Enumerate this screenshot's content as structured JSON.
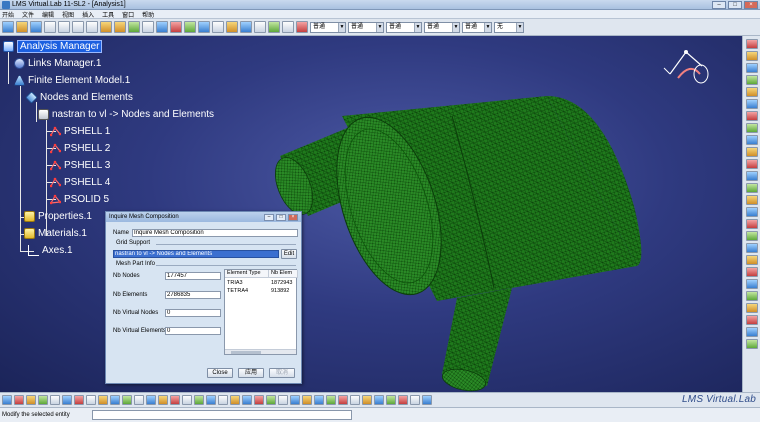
{
  "window": {
    "title": "LMS Virtual.Lab 11-SL2 - [Analysis1]",
    "controls": [
      "–",
      "□",
      "×"
    ]
  },
  "menu": [
    "开始",
    "文件",
    "编辑",
    "视图",
    "插入",
    "工具",
    "窗口",
    "帮助"
  ],
  "toolbar": {
    "selects": [
      "普通",
      "普通",
      "普通",
      "普通",
      "普通",
      "无"
    ]
  },
  "tree": {
    "nodes": [
      {
        "label": "Analysis Manager",
        "icon": "analysis-manager-icon"
      },
      {
        "label": "Links Manager.1",
        "icon": "links-manager-icon"
      },
      {
        "label": "Finite Element Model.1",
        "icon": "finite-element-model-icon"
      },
      {
        "label": "Nodes and Elements",
        "icon": "nodes-elements-icon"
      },
      {
        "label": "nastran to vl -> Nodes and Elements",
        "icon": "nastran-link-icon"
      },
      {
        "label": "PSHELL 1",
        "icon": "property-shell-icon"
      },
      {
        "label": "PSHELL 2",
        "icon": "property-shell-icon"
      },
      {
        "label": "PSHELL 3",
        "icon": "property-shell-icon"
      },
      {
        "label": "PSHELL 4",
        "icon": "property-shell-icon"
      },
      {
        "label": "PSOLID 5",
        "icon": "property-solid-icon"
      },
      {
        "label": "Properties.1",
        "icon": "folder-icon"
      },
      {
        "label": "Materials.1",
        "icon": "folder-icon"
      },
      {
        "label": "Axes.1",
        "icon": "axes-icon"
      }
    ]
  },
  "dialog": {
    "title": "Inquire Mesh Composition",
    "name_label": "Name",
    "name_value": "Inquire Mesh Composition",
    "grid_support_label": "Grid Support",
    "grid_support_value": "nastran to vl -> Nodes and Elements",
    "edit_button": "Edit",
    "mesh_part_info_label": "Mesh Part Info",
    "nb_nodes_label": "Nb Nodes",
    "nb_nodes_value": "177457",
    "nb_elements_label": "Nb Elements",
    "nb_elements_value": "2786835",
    "nb_virtual_nodes_label": "Nb Virtual Nodes",
    "nb_virtual_nodes_value": "0",
    "nb_virtual_elements_label": "Nb Virtual Elements",
    "nb_virtual_elements_value": "0",
    "table": {
      "headers": [
        "Element Type",
        "Nb Elem"
      ],
      "rows": [
        [
          "TRIA3",
          "1872943"
        ],
        [
          "TETRA4",
          "913892"
        ]
      ]
    },
    "close_button": "Close",
    "apply_button": "应用",
    "cancel_button": "取消"
  },
  "status": {
    "text": "Modify the selected entity"
  },
  "brand": "LMS Virtual.Lab",
  "colors": {
    "background": "#2f3a80",
    "mesh": "#1f7a1c",
    "selection": "#1b5fe0"
  }
}
